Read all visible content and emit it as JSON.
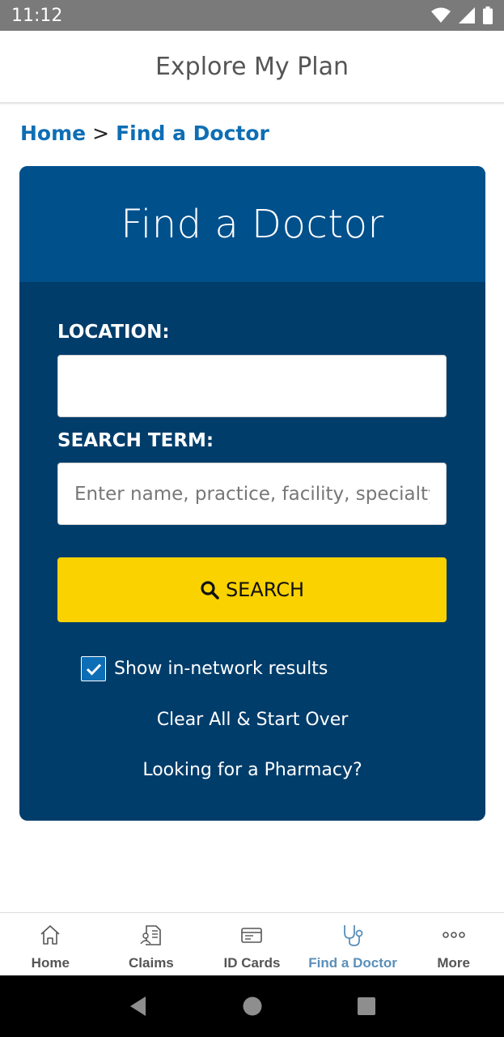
{
  "status_bar": {
    "time": "11:12"
  },
  "header": {
    "title": "Explore My Plan"
  },
  "breadcrumb": {
    "home": "Home",
    "separator": ">",
    "current": "Find a Doctor"
  },
  "card": {
    "title": "Find a Doctor",
    "location_label": "LOCATION:",
    "location_value": "",
    "search_term_label": "SEARCH TERM:",
    "search_term_placeholder": "Enter name, practice, facility, specialty",
    "search_button": "SEARCH",
    "in_network_label": "Show in-network results",
    "in_network_checked": true,
    "clear_link": "Clear All & Start Over",
    "pharmacy_link": "Looking for a Pharmacy?"
  },
  "tabs": [
    {
      "label": "Home",
      "icon": "home-icon"
    },
    {
      "label": "Claims",
      "icon": "claims-icon"
    },
    {
      "label": "ID Cards",
      "icon": "id-card-icon"
    },
    {
      "label": "Find a Doctor",
      "icon": "stethoscope-icon",
      "active": true
    },
    {
      "label": "More",
      "icon": "more-icon"
    }
  ],
  "colors": {
    "brand_dark": "#003d6b",
    "brand_header": "#00508c",
    "link_blue": "#0e6eb5",
    "search_yellow": "#f9d200",
    "active_tab": "#5b8fb9"
  }
}
